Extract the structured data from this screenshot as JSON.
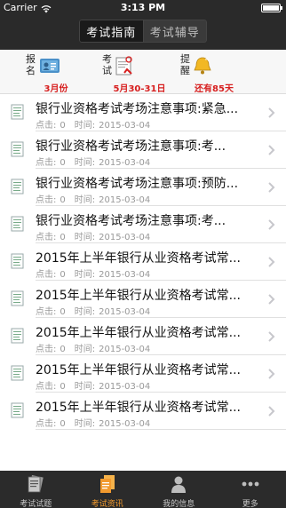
{
  "statusbar": {
    "carrier": "Carrier",
    "time": "3:13 PM"
  },
  "segment": {
    "tabs": [
      {
        "label": "考试指南"
      },
      {
        "label": "考试辅导"
      }
    ]
  },
  "info": {
    "items": [
      {
        "tag": "报名",
        "value": "3月份"
      },
      {
        "tag": "考试",
        "value": "5月30-31日"
      },
      {
        "tag": "提醒",
        "value": "还有85天"
      }
    ]
  },
  "list": {
    "clicks_label": "点击:",
    "time_label": "时间:",
    "rows": [
      {
        "title": "银行业资格考试考场注意事项:紧急...",
        "clicks": "0",
        "date": "2015-03-04"
      },
      {
        "title": "银行业资格考试考场注意事项:考...",
        "clicks": "0",
        "date": "2015-03-04"
      },
      {
        "title": "银行业资格考试考场注意事项:预防...",
        "clicks": "0",
        "date": "2015-03-04"
      },
      {
        "title": "银行业资格考试考场注意事项:考...",
        "clicks": "0",
        "date": "2015-03-04"
      },
      {
        "title": "2015年上半年银行从业资格考试常...",
        "clicks": "0",
        "date": "2015-03-04"
      },
      {
        "title": "2015年上半年银行从业资格考试常...",
        "clicks": "0",
        "date": "2015-03-04"
      },
      {
        "title": "2015年上半年银行从业资格考试常...",
        "clicks": "0",
        "date": "2015-03-04"
      },
      {
        "title": "2015年上半年银行从业资格考试常...",
        "clicks": "0",
        "date": "2015-03-04"
      },
      {
        "title": "2015年上半年银行从业资格考试常...",
        "clicks": "0",
        "date": "2015-03-04"
      }
    ]
  },
  "tabbar": {
    "tabs": [
      {
        "label": "考试试题",
        "icon": "exam-paper-icon"
      },
      {
        "label": "考试资讯",
        "icon": "news-icon",
        "active": true
      },
      {
        "label": "我的信息",
        "icon": "user-icon"
      },
      {
        "label": "更多",
        "icon": "more-icon"
      }
    ]
  },
  "colors": {
    "accent": "#f29a2e",
    "highlight_red": "#d71e1e",
    "nav_dark": "#2a2a2a"
  }
}
